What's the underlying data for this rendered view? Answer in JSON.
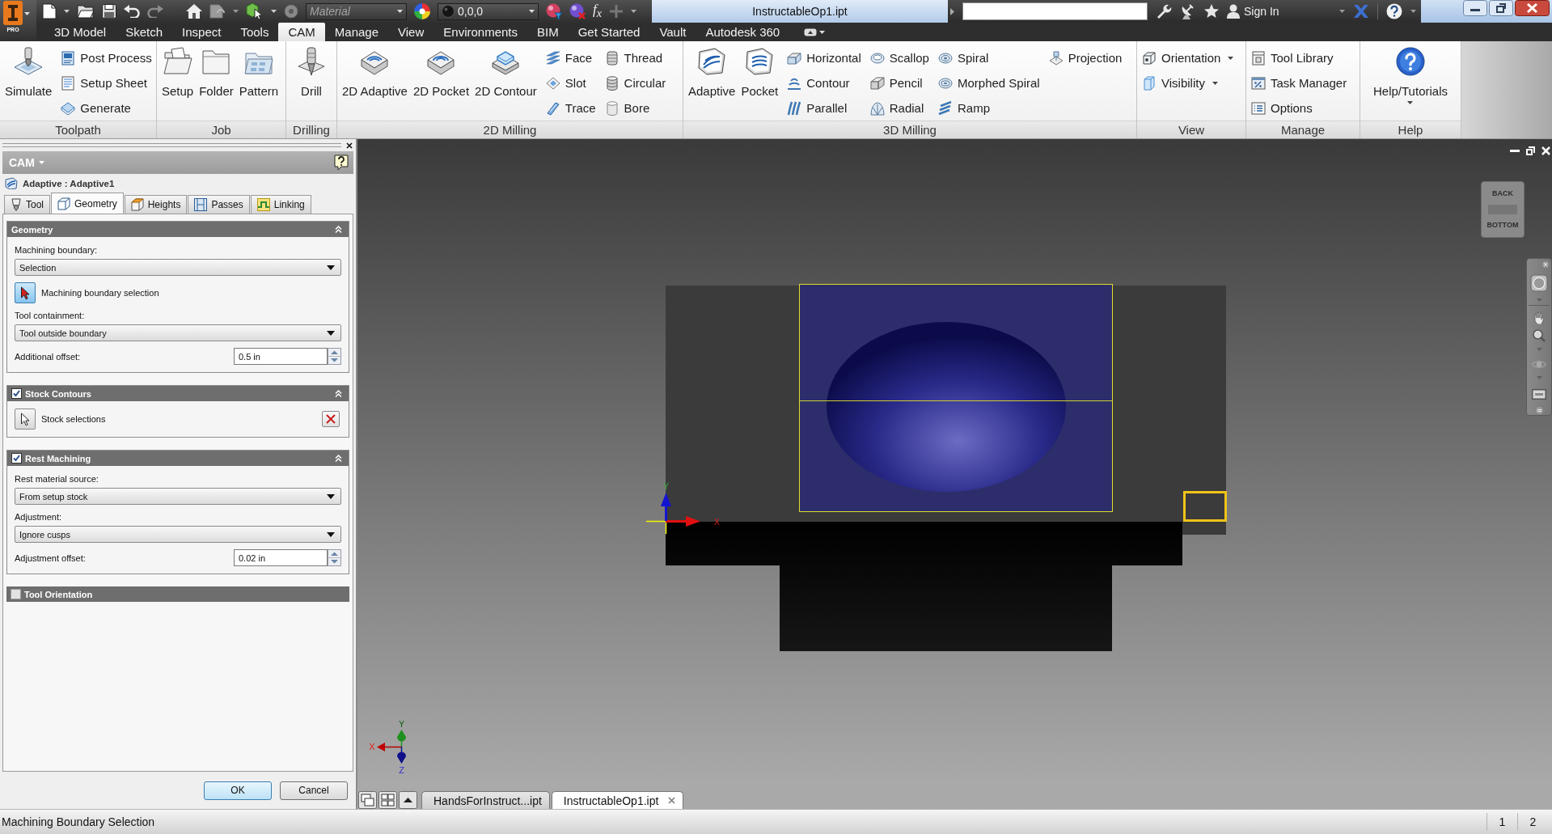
{
  "title_bar": {
    "app_badge": "PRO",
    "material_combo": {
      "placeholder": "Material"
    },
    "appearance_combo": {
      "value": "0,0,0"
    },
    "function_button": "f$_{x}$",
    "title": "InstructableOp1.ipt",
    "sign_in": "Sign In"
  },
  "ribbon_tabs": [
    {
      "label": "3D Model",
      "selected": false
    },
    {
      "label": "Sketch",
      "selected": false
    },
    {
      "label": "Inspect",
      "selected": false
    },
    {
      "label": "Tools",
      "selected": false
    },
    {
      "label": "CAM",
      "selected": true
    },
    {
      "label": "Manage",
      "selected": false
    },
    {
      "label": "View",
      "selected": false
    },
    {
      "label": "Environments",
      "selected": false
    },
    {
      "label": "BIM",
      "selected": false
    },
    {
      "label": "Get Started",
      "selected": false
    },
    {
      "label": "Vault",
      "selected": false
    },
    {
      "label": "Autodesk 360",
      "selected": false
    }
  ],
  "ribbon": {
    "panels": [
      {
        "label": "Toolpath",
        "groups": [
          {
            "kind": "large",
            "buttons": [
              {
                "label": "Simulate"
              }
            ]
          },
          {
            "kind": "stack",
            "buttons": [
              {
                "label": "Post Process"
              },
              {
                "label": "Setup Sheet"
              },
              {
                "label": "Generate"
              }
            ]
          }
        ]
      },
      {
        "label": "Job",
        "groups": [
          {
            "kind": "large",
            "buttons": [
              {
                "label": "Setup"
              },
              {
                "label": "Folder"
              },
              {
                "label": "Pattern"
              }
            ]
          }
        ]
      },
      {
        "label": "Drilling",
        "groups": [
          {
            "kind": "large",
            "buttons": [
              {
                "label": "Drill"
              }
            ]
          }
        ]
      },
      {
        "label": "2D Milling",
        "groups": [
          {
            "kind": "large",
            "buttons": [
              {
                "label": "2D Adaptive"
              },
              {
                "label": "2D Pocket"
              },
              {
                "label": "2D Contour"
              }
            ]
          },
          {
            "kind": "stack",
            "buttons": [
              {
                "label": "Face"
              },
              {
                "label": "Slot"
              },
              {
                "label": "Trace"
              }
            ]
          },
          {
            "kind": "stack",
            "buttons": [
              {
                "label": "Thread"
              },
              {
                "label": "Circular"
              },
              {
                "label": "Bore"
              }
            ]
          }
        ]
      },
      {
        "label": "3D Milling",
        "groups": [
          {
            "kind": "large",
            "buttons": [
              {
                "label": "Adaptive"
              },
              {
                "label": "Pocket"
              }
            ]
          },
          {
            "kind": "stack",
            "buttons": [
              {
                "label": "Horizontal"
              },
              {
                "label": "Contour"
              },
              {
                "label": "Parallel"
              }
            ]
          },
          {
            "kind": "stack",
            "buttons": [
              {
                "label": "Scallop"
              },
              {
                "label": "Pencil"
              },
              {
                "label": "Radial"
              }
            ]
          },
          {
            "kind": "stack",
            "buttons": [
              {
                "label": "Spiral"
              },
              {
                "label": "Morphed Spiral"
              },
              {
                "label": "Ramp"
              }
            ]
          },
          {
            "kind": "stack",
            "buttons": [
              {
                "label": "Projection"
              }
            ]
          }
        ]
      },
      {
        "label": "View",
        "groups": [
          {
            "kind": "stack",
            "buttons": [
              {
                "label": "Orientation",
                "menu": true
              },
              {
                "label": "Visibility",
                "menu": true
              }
            ]
          }
        ]
      },
      {
        "label": "Manage",
        "groups": [
          {
            "kind": "stack",
            "buttons": [
              {
                "label": "Tool Library"
              },
              {
                "label": "Task Manager"
              },
              {
                "label": "Options"
              }
            ]
          }
        ]
      },
      {
        "label": "Help",
        "groups": [
          {
            "kind": "large",
            "buttons": [
              {
                "label": "Help/Tutorials",
                "menu": true
              }
            ]
          }
        ]
      }
    ]
  },
  "cam_panel": {
    "title": "CAM",
    "operation": "Adaptive : Adaptive1",
    "tabs": [
      {
        "label": "Tool",
        "selected": false
      },
      {
        "label": "Geometry",
        "selected": true
      },
      {
        "label": "Heights",
        "selected": false
      },
      {
        "label": "Passes",
        "selected": false
      },
      {
        "label": "Linking",
        "selected": false
      }
    ],
    "sections": [
      {
        "title": "Geometry",
        "expanded": true,
        "rows": [
          {
            "kind": "dropdown",
            "label": "Machining boundary:",
            "value": "Selection"
          },
          {
            "kind": "pick",
            "label": "Machining boundary selection",
            "active": true
          },
          {
            "kind": "dropdown",
            "label": "Tool containment:",
            "value": "Tool outside boundary"
          },
          {
            "kind": "number",
            "label": "Additional offset:",
            "value": "0.5 in"
          }
        ]
      },
      {
        "title": "Stock Contours",
        "checked": true,
        "expanded": true,
        "rows": [
          {
            "kind": "pick",
            "label": "Stock selections",
            "active": false,
            "clear_button": true
          }
        ]
      },
      {
        "title": "Rest Machining",
        "checked": true,
        "expanded": true,
        "rows": [
          {
            "kind": "dropdown",
            "label": "Rest material source:",
            "value": "From setup stock"
          },
          {
            "kind": "dropdown",
            "label": "Adjustment:",
            "value": "Ignore cusps"
          },
          {
            "kind": "number",
            "label": "Adjustment offset:",
            "value": "0.02 in"
          }
        ]
      },
      {
        "title": "Tool Orientation",
        "checked": false,
        "expanded": false
      }
    ],
    "buttons": [
      {
        "label": "OK",
        "default": true
      },
      {
        "label": "Cancel",
        "default": false
      }
    ]
  },
  "viewport": {
    "view_cube": {
      "faces": [
        "BACK",
        "BOTTOM"
      ]
    },
    "origin_axes": {
      "y": "Y",
      "x": "X"
    },
    "view_axes": {
      "x": "X",
      "y": "Y",
      "z": "Z"
    }
  },
  "document_tabs": [
    {
      "label": "HandsForInstruct...ipt",
      "selected": false
    },
    {
      "label": "InstructableOp1.ipt",
      "selected": true
    }
  ],
  "status_bar": {
    "message": "Machining Boundary Selection",
    "fields": [
      "1",
      "2"
    ]
  }
}
